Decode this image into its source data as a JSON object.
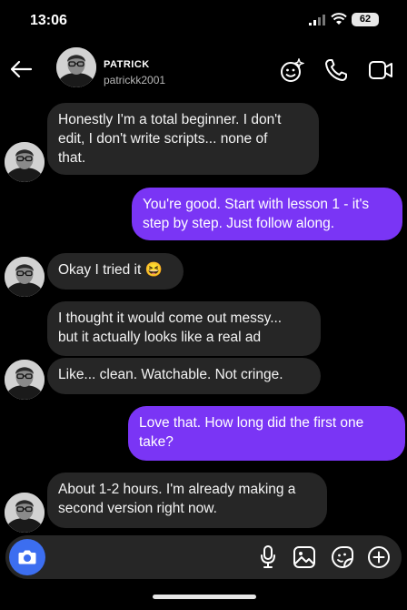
{
  "status_bar": {
    "time": "13:06",
    "battery": "62"
  },
  "header": {
    "name": "PATRICK",
    "username": "patrickk2001"
  },
  "messages": [
    {
      "from": "them",
      "text": "Honestly I'm a total beginner. I don't\nedit, I don't write scripts... none of\nthat."
    },
    {
      "from": "me",
      "text": "You're good. Start with lesson 1 - it's\nstep by step. Just follow along."
    },
    {
      "from": "them",
      "text": "Okay I tried it 😆"
    },
    {
      "from": "them",
      "text": "I thought it would come out messy...\nbut it actually looks like a real ad"
    },
    {
      "from": "them",
      "text": "Like... clean. Watchable. Not cringe."
    },
    {
      "from": "me",
      "text": "Love that. How long did the first one\ntake?"
    },
    {
      "from": "them",
      "text": "About 1-2 hours. I'm already making a\nsecond version right now."
    }
  ],
  "icons": {
    "status": [
      "signal-icon",
      "wifi-icon",
      "battery-icon"
    ],
    "header": [
      "back-arrow-icon",
      "effects-icon",
      "phone-icon",
      "video-icon"
    ],
    "composer": [
      "camera-icon",
      "microphone-icon",
      "gallery-icon",
      "sticker-icon",
      "plus-icon"
    ]
  },
  "colors": {
    "outgoing_bubble": "#7a35f5",
    "incoming_bubble": "#262626",
    "camera_button": "#3c6ef0",
    "background": "#000000"
  }
}
